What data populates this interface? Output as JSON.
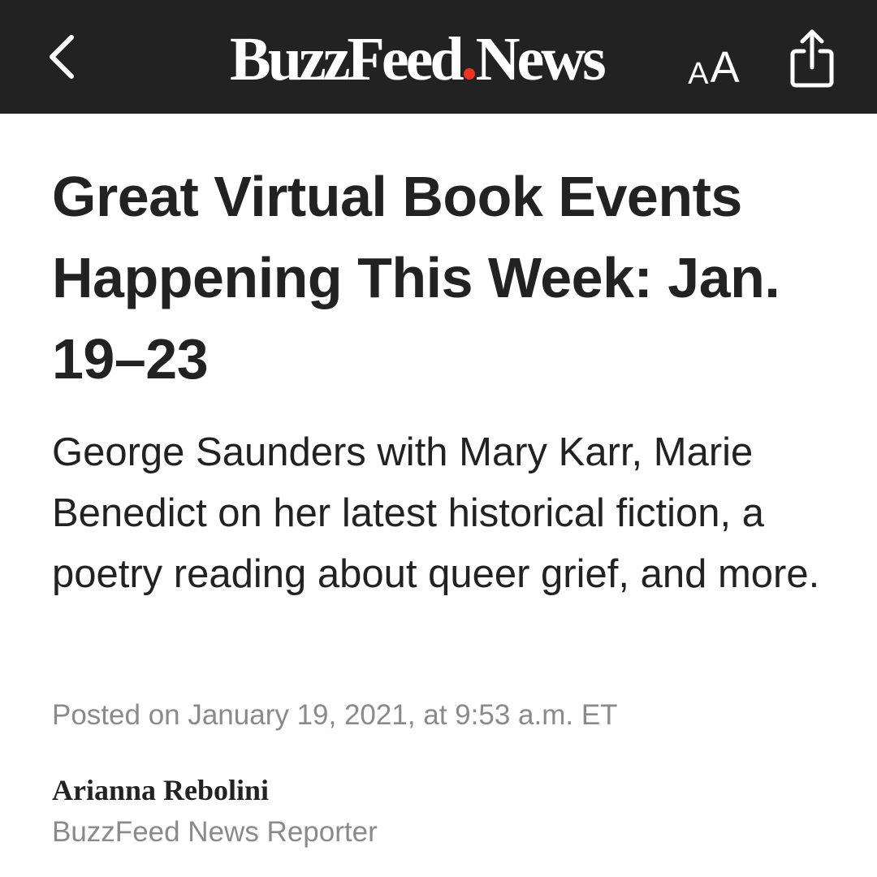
{
  "colors": {
    "topbar_background": "#222222",
    "brand_dot": "#ee3322",
    "headline_text": "#222222",
    "meta_text": "#8a8a8a"
  },
  "navbar": {
    "back_icon": "chevron-left-icon",
    "logo_part1": "BuzzFeed",
    "logo_part2": "News",
    "text_size_small": "A",
    "text_size_large": "A",
    "share_icon": "share-icon"
  },
  "article": {
    "headline": "Great Virtual Book Events Happening This Week: Jan. 19–23",
    "dek": "George Saunders with Mary Karr, Marie Benedict on her latest historical fiction, a poetry reading about queer grief, and more.",
    "posted": "Posted on January 19, 2021, at 9:53 a.m. ET",
    "author_name": "Arianna Rebolini",
    "author_title": "BuzzFeed News Reporter"
  }
}
